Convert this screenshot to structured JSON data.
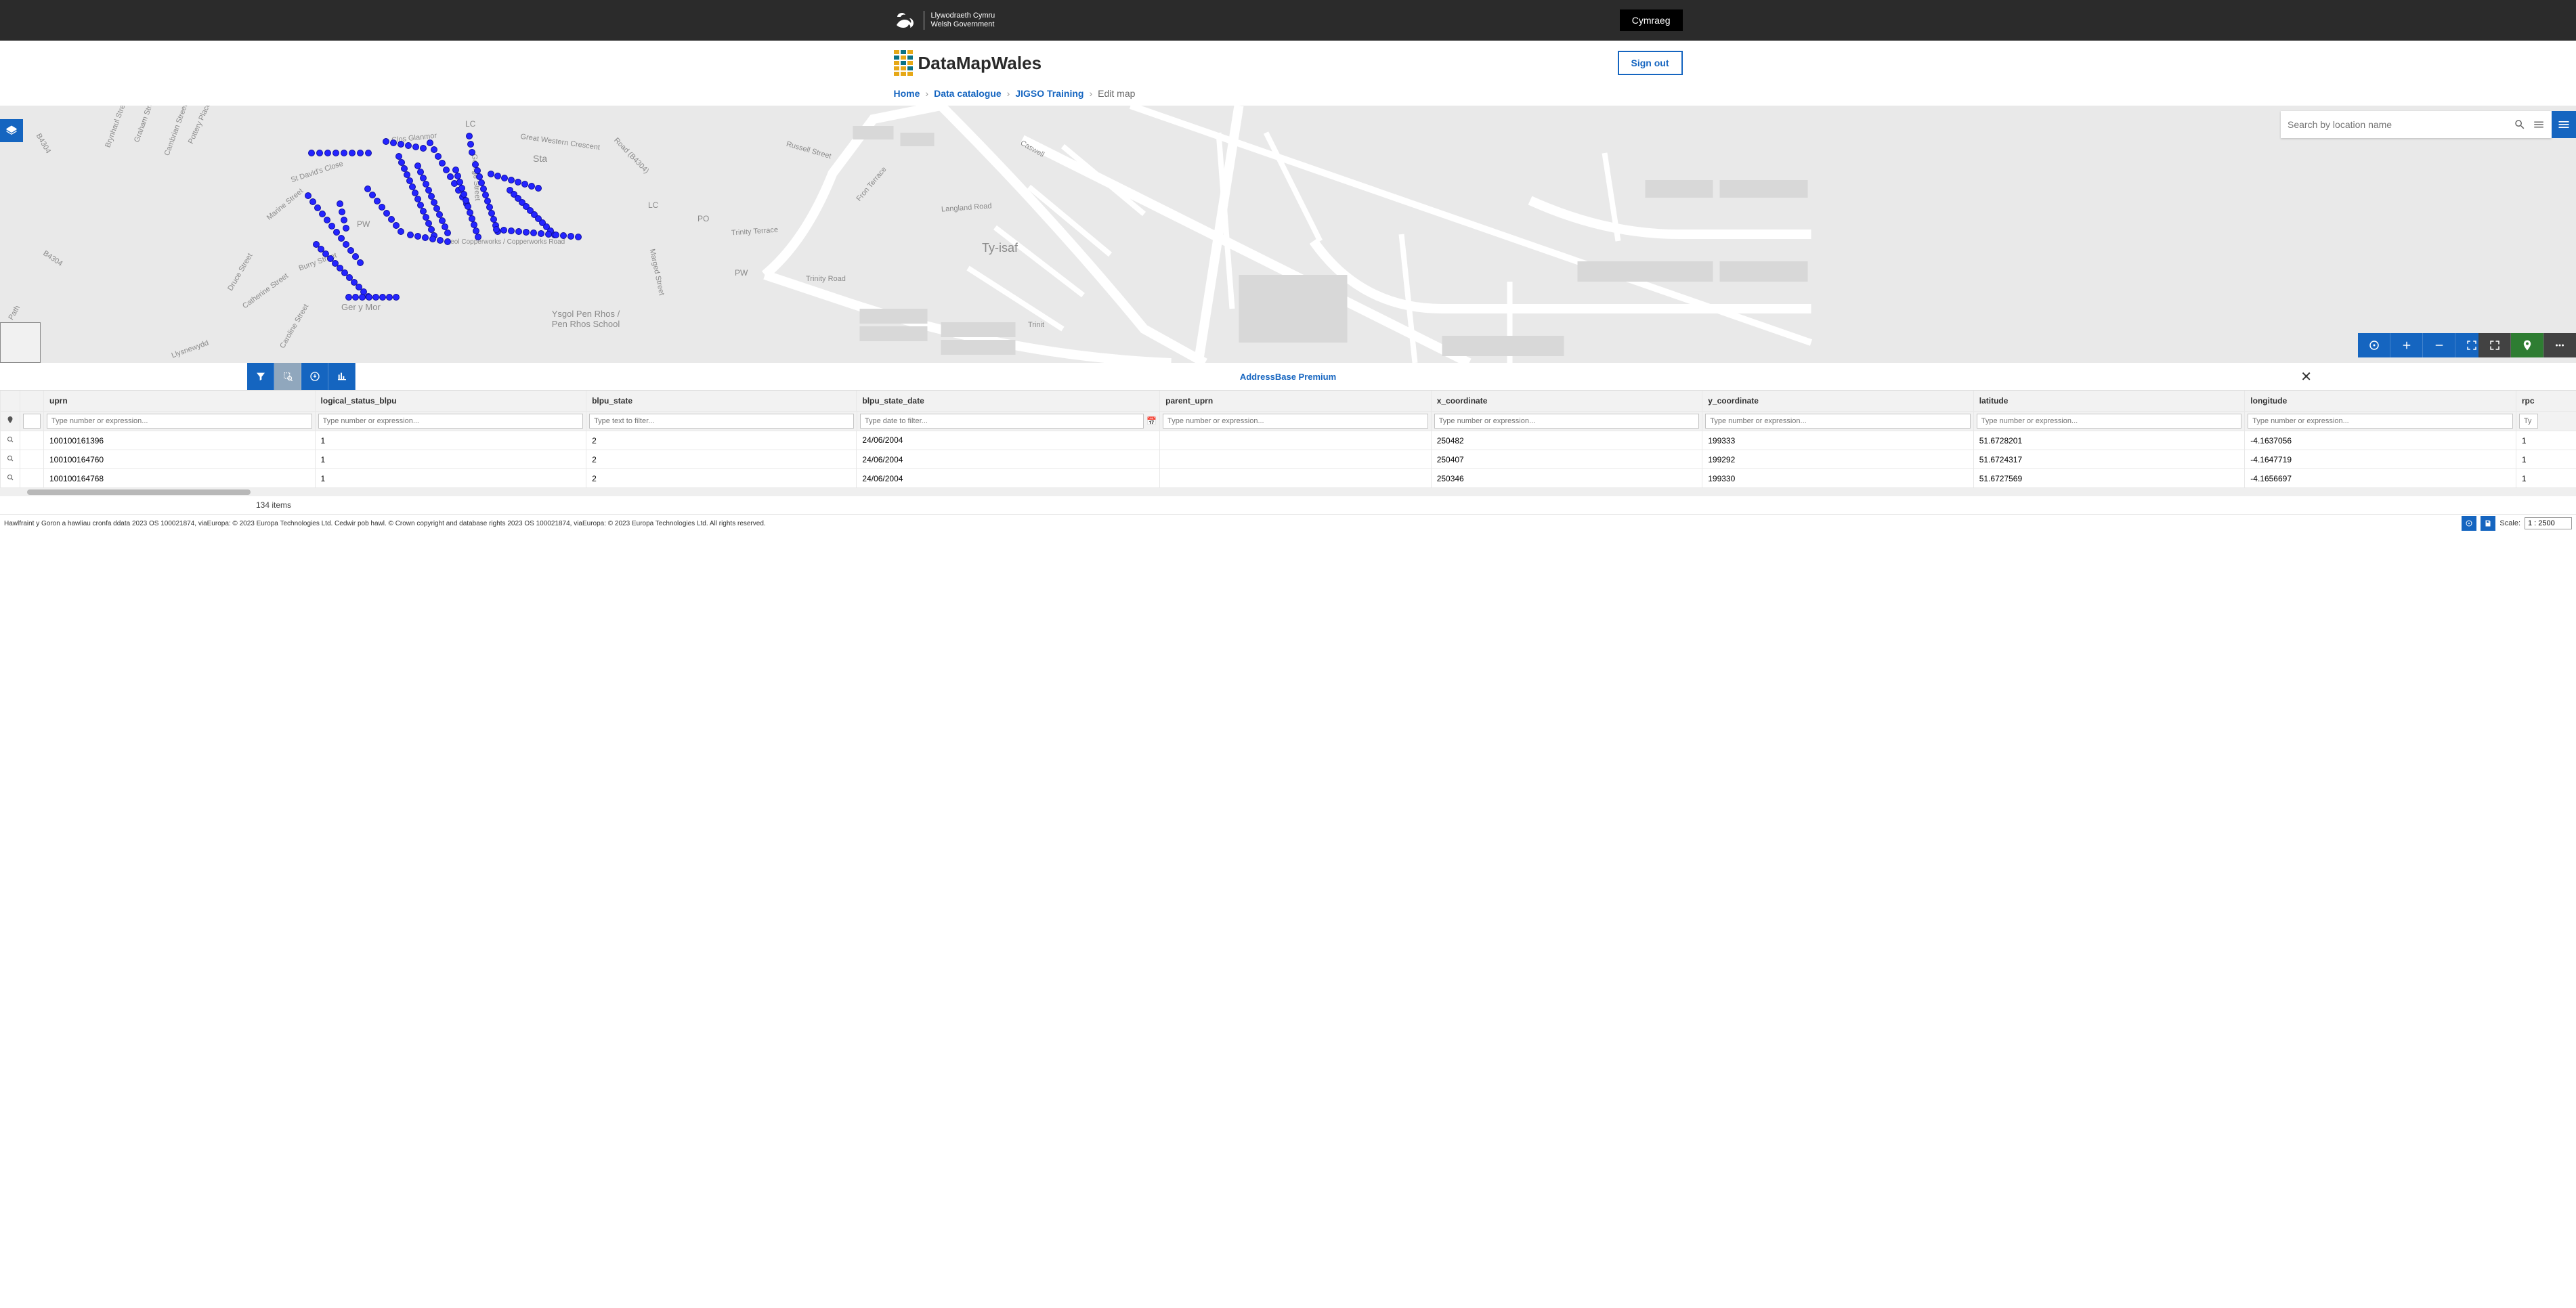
{
  "gov": {
    "line1": "Llywodraeth Cymru",
    "line2": "Welsh Government",
    "lang_button": "Cymraeg"
  },
  "brand": {
    "name": "DataMapWales",
    "signout": "Sign out"
  },
  "breadcrumbs": {
    "home": "Home",
    "catalogue": "Data catalogue",
    "dataset": "JIGSO Training",
    "current": "Edit map"
  },
  "search": {
    "placeholder": "Search by location name"
  },
  "map": {
    "labels": {
      "sta": "Sta",
      "lc1": "LC",
      "lc2": "LC",
      "po": "PO",
      "pw1": "PW",
      "pw2": "PW",
      "ty_isaf": "Ty-isaf",
      "trinity_road": "Trinity Road",
      "trinity_terrace": "Trinity Terrace",
      "langland_road": "Langland Road",
      "fron_terrace": "Fron Terrace",
      "russell_street": "Russell Street",
      "caswell": "Caswell",
      "trinit": "Trinit",
      "ysgol": "Ysgol Pen Rhos / Pen Rhos School",
      "ger_y_mor": "Ger y Mor",
      "copperworks": "Heol Copperworks / Copperworks Road",
      "george_st": "George Street",
      "clos_glanmor": "Clos Glanmor",
      "st_davids": "St David's Close",
      "marine_st": "Marine Street",
      "burry_st": "Burry Street",
      "catherine_st": "Catherine Street",
      "druce_st": "Druce Street",
      "caroline_st": "Caroline Street",
      "llysnewydd": "Llysnewydd",
      "b4304_1": "B4304",
      "b4304_2": "B4304",
      "path": "Path",
      "great_western": "Great Western Crescent",
      "cambrian_st": "Cambrian Street",
      "road_b4304": "Road (B4304)",
      "marged_st": "Marged Street",
      "brynhaul_st": "Brynhaul Street",
      "graham_st": "Graham Street",
      "pottery_pl": "Pottery Place"
    }
  },
  "panel": {
    "title": "AddressBase Premium",
    "item_count": "134 items"
  },
  "columns": {
    "uprn": "uprn",
    "logical_status_blpu": "logical_status_blpu",
    "blpu_state": "blpu_state",
    "blpu_state_date": "blpu_state_date",
    "parent_uprn": "parent_uprn",
    "x_coordinate": "x_coordinate",
    "y_coordinate": "y_coordinate",
    "latitude": "latitude",
    "longitude": "longitude",
    "rpc": "rpc"
  },
  "filters": {
    "num_placeholder": "Type number or expression...",
    "text_placeholder": "Type text to filter...",
    "date_placeholder": "Type date to filter...",
    "short_placeholder": "Ty"
  },
  "rows": [
    {
      "uprn": "100100161396",
      "logical_status_blpu": "1",
      "blpu_state": "2",
      "blpu_state_date": "24/06/2004",
      "parent_uprn": "",
      "x_coordinate": "250482",
      "y_coordinate": "199333",
      "latitude": "51.6728201",
      "longitude": "-4.1637056",
      "rpc": "1"
    },
    {
      "uprn": "100100164760",
      "logical_status_blpu": "1",
      "blpu_state": "2",
      "blpu_state_date": "24/06/2004",
      "parent_uprn": "",
      "x_coordinate": "250407",
      "y_coordinate": "199292",
      "latitude": "51.6724317",
      "longitude": "-4.1647719",
      "rpc": "1"
    },
    {
      "uprn": "100100164768",
      "logical_status_blpu": "1",
      "blpu_state": "2",
      "blpu_state_date": "24/06/2004",
      "parent_uprn": "",
      "x_coordinate": "250346",
      "y_coordinate": "199330",
      "latitude": "51.6727569",
      "longitude": "-4.1656697",
      "rpc": "1"
    }
  ],
  "footer": {
    "copyright": "Hawlfraint y Goron a hawliau cronfa ddata 2023 OS 100021874, viaEuropa: © 2023 Europa Technologies Ltd. Cedwir pob hawl. © Crown copyright and database rights 2023 OS 100021874, viaEuropa: © 2023 Europa Technologies Ltd. All rights reserved.",
    "scale_label": "Scale:",
    "scale_value": "1 : 2500"
  }
}
